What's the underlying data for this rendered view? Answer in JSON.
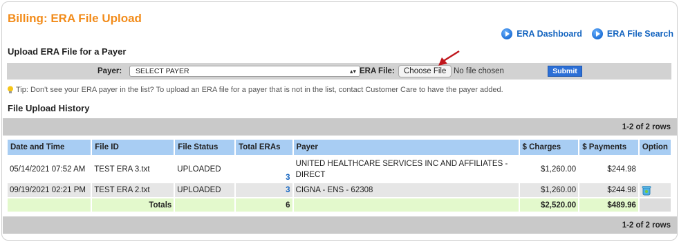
{
  "page": {
    "title": "Billing: ERA File Upload"
  },
  "links": {
    "dashboard": "ERA Dashboard",
    "search": "ERA File Search"
  },
  "upload": {
    "heading": "Upload ERA File for a Payer",
    "payer_label": "Payer:",
    "payer_selected": "SELECT PAYER",
    "file_label": "ERA File:",
    "choose_file": "Choose File",
    "no_file": "No file chosen",
    "submit": "Submit"
  },
  "tip": "Tip: Don't see your ERA payer in the list? To upload an ERA file for a payer that is not in the list, contact Customer Care to have the payer added.",
  "history": {
    "heading": "File Upload History",
    "rows_count": "1-2 of 2 rows",
    "columns": [
      "Date and Time",
      "File ID",
      "File Status",
      "Total ERAs",
      "Payer",
      "$ Charges",
      "$ Payments",
      "Option"
    ],
    "rows": [
      {
        "date": "05/14/2021 07:52 AM",
        "file_id": "TEST ERA 3.txt",
        "status": "UPLOADED",
        "total": "3",
        "payer": "UNITED HEALTHCARE SERVICES INC AND AFFILIATES - DIRECT",
        "charges": "$1,260.00",
        "payments": "$244.98"
      },
      {
        "date": "09/19/2021 02:21 PM",
        "file_id": "TEST ERA 2.txt",
        "status": "UPLOADED",
        "total": "3",
        "payer": "CIGNA - ENS - 62308",
        "charges": "$1,260.00",
        "payments": "$244.98",
        "option_icon": "trash-icon"
      }
    ],
    "totals": {
      "label": "Totals",
      "total": "6",
      "charges": "$2,520.00",
      "payments": "$489.96"
    }
  },
  "colors": {
    "title": "#f28c1b",
    "link": "#1565c0",
    "header_bg": "#a8cdf3",
    "totals_bg": "#e3f9cc",
    "submit_bg": "#2c6fd6"
  }
}
